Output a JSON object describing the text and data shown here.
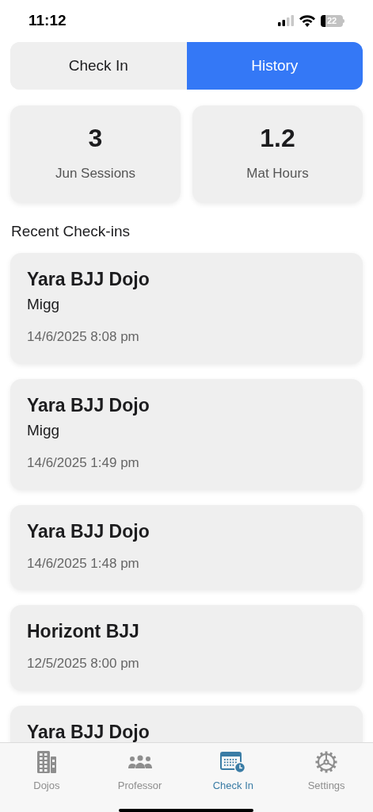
{
  "status_bar": {
    "time": "11:12",
    "battery": "22"
  },
  "segments": [
    {
      "label": "Check In",
      "selected": false
    },
    {
      "label": "History",
      "selected": true
    }
  ],
  "stats": [
    {
      "value": "3",
      "label": "Jun Sessions"
    },
    {
      "value": "1.2",
      "label": "Mat Hours"
    }
  ],
  "section_title": "Recent Check-ins",
  "checkins": [
    {
      "dojo": "Yara BJJ Dojo",
      "professor": "Migg",
      "time": "14/6/2025 8:08 pm"
    },
    {
      "dojo": "Yara BJJ Dojo",
      "professor": "Migg",
      "time": "14/6/2025 1:49 pm"
    },
    {
      "dojo": "Yara BJJ Dojo",
      "time": "14/6/2025 1:48 pm"
    },
    {
      "dojo": "Horizont BJJ",
      "time": "12/5/2025 8:00 pm"
    },
    {
      "dojo": "Yara BJJ Dojo"
    }
  ],
  "tab_bar": [
    {
      "label": "Dojos",
      "kind": "building",
      "selected": false
    },
    {
      "label": "Professor",
      "kind": "people",
      "selected": false
    },
    {
      "label": "Check In",
      "kind": "calendar",
      "selected": true
    },
    {
      "label": "Settings",
      "kind": "gear",
      "selected": false
    }
  ]
}
